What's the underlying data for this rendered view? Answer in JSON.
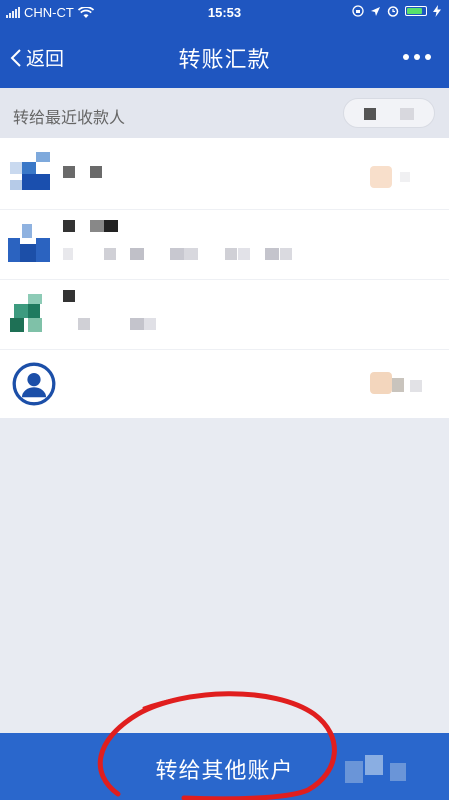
{
  "status_bar": {
    "carrier": "CHN-CT",
    "time": "15:53",
    "wifi_icon": "wifi-icon",
    "location_icon": "location-arrow-icon",
    "alarm_icon": "alarm-icon",
    "battery_level": 0.85,
    "battery_color": "#57e06b"
  },
  "nav": {
    "back_label": "返回",
    "title": "转账汇款",
    "more_icon": "more-dots-icon",
    "bg_color": "#1f56c0"
  },
  "section": {
    "title": "转给最近收款人"
  },
  "payees": [
    {
      "icon": "bank-logo-blue-square"
    },
    {
      "icon": "bank-logo-blue-building"
    },
    {
      "icon": "bank-logo-green-arch"
    },
    {
      "icon": "person-avatar-icon"
    }
  ],
  "bottom_button": {
    "label": "转给其他账户",
    "bg_color": "#2a67cc"
  },
  "annotation": {
    "red_circle_color": "#e01e1e"
  }
}
